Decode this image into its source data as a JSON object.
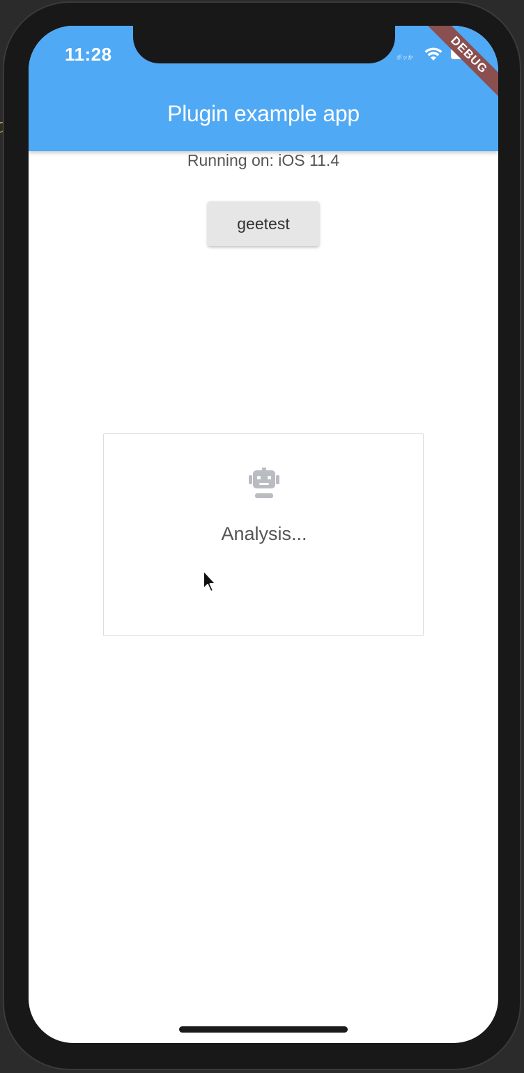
{
  "status_bar": {
    "time": "11:28",
    "carrier_text": "ボッか",
    "icons": [
      "wifi-icon",
      "battery-icon"
    ]
  },
  "debug_banner": {
    "label": "DEBUG"
  },
  "app_bar": {
    "title": "Plugin example app"
  },
  "body": {
    "platform_text": "Running on: iOS 11.4",
    "geetest_button_label": "geetest"
  },
  "captcha_dialog": {
    "icon": "robot-icon",
    "status_text": "Analysis..."
  },
  "colors": {
    "app_bar": "#4fa9f4",
    "debug_banner": "#8c4f4f",
    "button_bg": "#e6e6e6",
    "robot_icon": "#b9bcc1"
  }
}
